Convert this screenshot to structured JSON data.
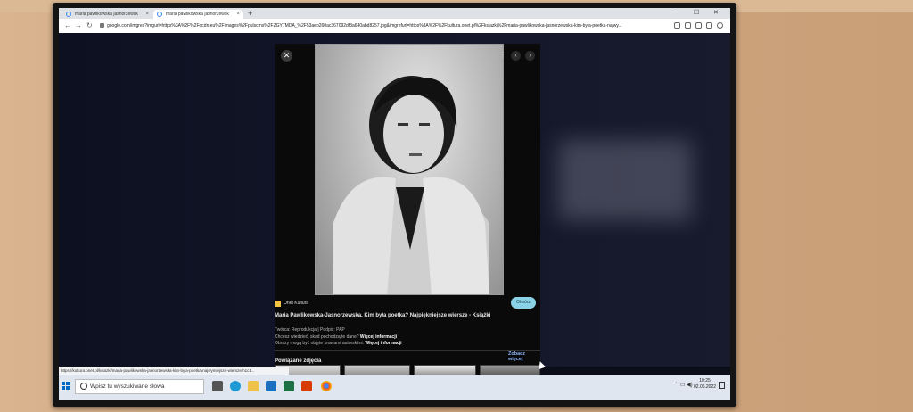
{
  "browser": {
    "tabs": [
      {
        "label": "maria pawlikowska jasnorzewsk"
      },
      {
        "label": "maria pawlikowska jasnorzewsk"
      }
    ],
    "new_tab": "+",
    "url": "google.com/imgres?imgurl=https%3A%2F%2Focdn.eu%2Fimages%2Fpulscms%2FZGY7MDA_%2F53aeb260ac367092df3a640abd8257.jpg&imgrefurl=https%3A%2F%2Fkultura.onet.pl%2Fksiazki%2Fmaria-pawlikowska-jasnorzewska-kim-byla-poetka-najwy..."
  },
  "viewer": {
    "source": "Onet Kultura",
    "visit_label": "Otwórz",
    "title": "Maria Pawlikowska-Jasnorzewska. Kim była poetka? Najpiękniejsze wiersze - Książki",
    "credit": "Twórca: Reprodukcja | Podpis: PAP",
    "origin_q": "Chcesz wiedzieć, skąd pochodzą te dane?",
    "origin_link": "Więcej informacji",
    "rights_q": "Obrazy mogą być objęte prawami autorskimi.",
    "rights_link": "Więcej informacji",
    "see_more": "Zobacz więcej",
    "related_title": "Powiązane zdjęcia"
  },
  "status_link": "https://kultura.onet.pl/ksiazki/maria-pawlikowska-jasnorzewska-kim-byla-poetka-najwymiejsze-wiersze/n1c1...",
  "taskbar": {
    "search_placeholder": "Wpisz tu wyszukiwane słowa",
    "time": "10:25",
    "date": "02.06.2022"
  },
  "colors": {
    "page_bg": "#121628",
    "accent": "#8ab4f8",
    "visit_button": "#8ad3e6",
    "taskbar": "#dfe6ef"
  },
  "icons": [
    "search-icon",
    "close-icon",
    "more-icon",
    "chevron-left-icon",
    "chevron-right-icon",
    "windows-icon",
    "edge-icon",
    "chrome-icon",
    "lock-icon"
  ]
}
